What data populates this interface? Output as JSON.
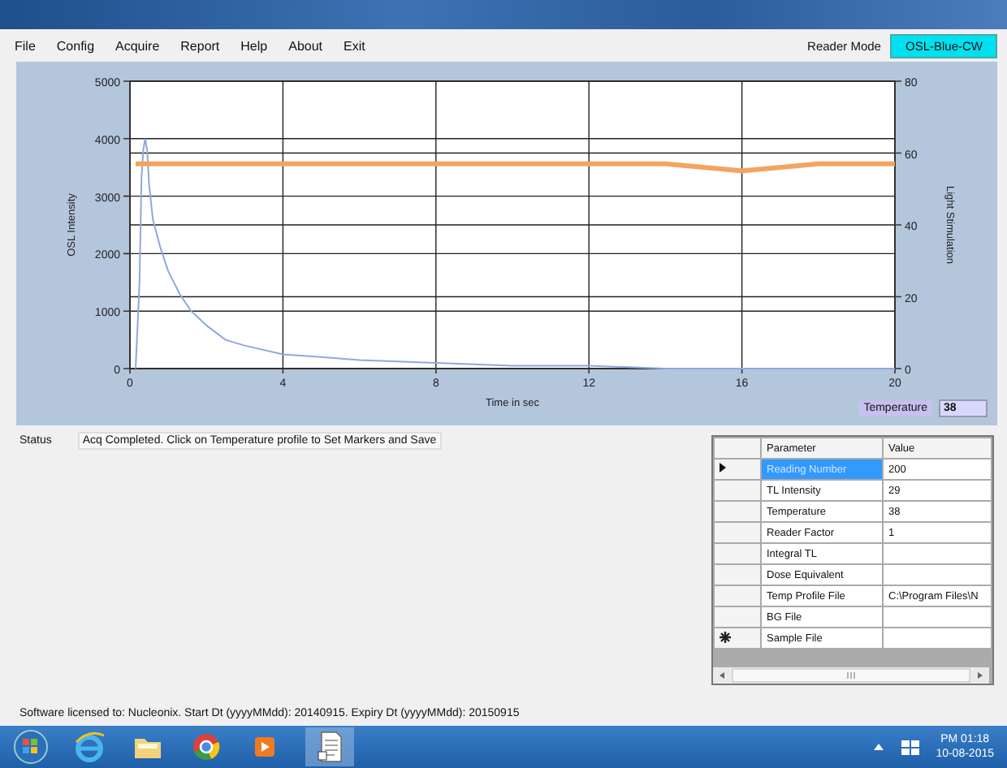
{
  "menu": [
    "File",
    "Config",
    "Acquire",
    "Report",
    "Help",
    "About",
    "Exit"
  ],
  "reader_mode": {
    "label": "Reader Mode",
    "value": "OSL-Blue-CW"
  },
  "chart": {
    "chart_data": {
      "type": "line",
      "xlabel": "Time in sec",
      "ylabel": "OSL Intensity",
      "xlim": [
        0,
        20
      ],
      "ylim": [
        0,
        5000
      ],
      "xticks": [
        0,
        4,
        8,
        12,
        16,
        20
      ],
      "yticks": [
        0,
        1000,
        2000,
        3000,
        4000,
        5000
      ],
      "grid": true,
      "y2label": "Light Stimulation",
      "y2lim": [
        0,
        80
      ],
      "y2ticks": [
        0,
        20,
        40,
        60,
        80
      ],
      "x": [
        0.15,
        0.25,
        0.3,
        0.35,
        0.4,
        0.45,
        0.5,
        0.6,
        0.8,
        1,
        1.3,
        1.6,
        2,
        2.5,
        3,
        4,
        5,
        6,
        8,
        10,
        12,
        14,
        16,
        18,
        20
      ],
      "series": [
        {
          "color": "#8fa8dc",
          "values": [
            0,
            1500,
            3300,
            3800,
            4000,
            3800,
            3200,
            2600,
            2100,
            1700,
            1300,
            1000,
            750,
            500,
            400,
            250,
            200,
            150,
            100,
            50,
            50,
            0,
            0,
            0,
            0
          ]
        },
        {
          "color": "#f4a460",
          "axis": "y2",
          "values": [
            57,
            57,
            57,
            57,
            57,
            57,
            57,
            57,
            57,
            57,
            57,
            57,
            57,
            57,
            57,
            57,
            57,
            57,
            57,
            57,
            57,
            57,
            55,
            57,
            57
          ]
        }
      ]
    }
  },
  "temperature": {
    "label": "Temperature",
    "value": "38"
  },
  "status": {
    "label": "Status",
    "text": "Acq Completed. Click on Temperature profile to Set Markers and Save"
  },
  "grid": {
    "columns": [
      "Parameter",
      "Value"
    ],
    "rows": [
      {
        "current": true,
        "new_row": false,
        "selected": true,
        "cells": [
          "Reading Number",
          "200"
        ]
      },
      {
        "current": false,
        "new_row": false,
        "selected": false,
        "cells": [
          "TL Intensity",
          "29"
        ]
      },
      {
        "current": false,
        "new_row": false,
        "selected": false,
        "cells": [
          "Temperature",
          "38"
        ]
      },
      {
        "current": false,
        "new_row": false,
        "selected": false,
        "cells": [
          "Reader Factor",
          "1"
        ]
      },
      {
        "current": false,
        "new_row": false,
        "selected": false,
        "cells": [
          "Integral TL",
          ""
        ]
      },
      {
        "current": false,
        "new_row": false,
        "selected": false,
        "cells": [
          "Dose Equivalent",
          ""
        ]
      },
      {
        "current": false,
        "new_row": false,
        "selected": false,
        "cells": [
          "Temp Profile File",
          "C:\\Program Files\\N"
        ]
      },
      {
        "current": false,
        "new_row": false,
        "selected": false,
        "cells": [
          "BG File",
          ""
        ]
      },
      {
        "current": false,
        "new_row": true,
        "selected": false,
        "cells": [
          "Sample File",
          ""
        ]
      }
    ]
  },
  "license": "Software licensed to: Nucleonix. Start Dt (yyyyMMdd): 20140915. Expiry Dt (yyyyMMdd): 20150915",
  "taskbar": {
    "time": "PM 01:18",
    "date": "10-08-2015"
  }
}
